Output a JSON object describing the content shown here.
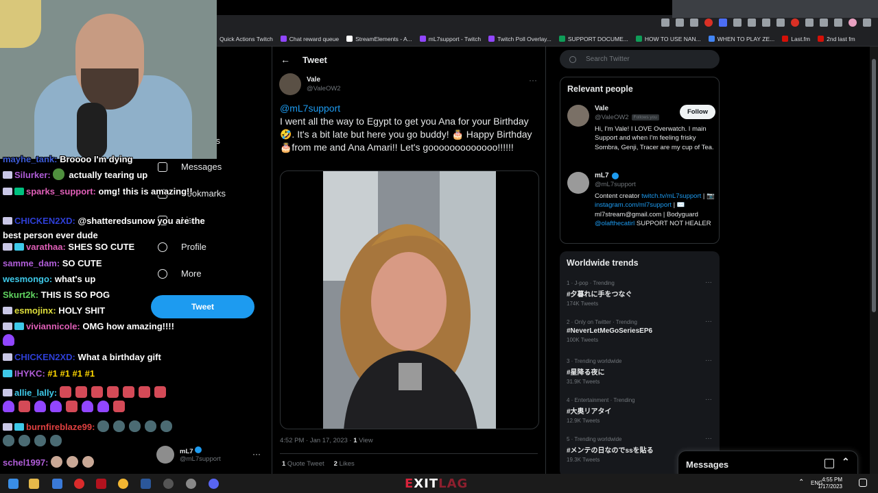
{
  "browser": {
    "bookmarks": [
      {
        "label": "Quick Actions Twitch",
        "color": ""
      },
      {
        "label": "Chat reward queue",
        "color": "#9146ff"
      },
      {
        "label": "StreamElements - A...",
        "color": "#ffffff"
      },
      {
        "label": "mL7support - Twitch",
        "color": "#9146ff"
      },
      {
        "label": "Twitch Poll Overlay...",
        "color": "#9146ff"
      },
      {
        "label": "SUPPORT DOCUME...",
        "color": "#0f9d58"
      },
      {
        "label": "HOW TO USE NAN...",
        "color": "#0f9d58"
      },
      {
        "label": "WHEN TO PLAY ZE...",
        "color": "#4285f4"
      },
      {
        "label": "Last.fm",
        "color": "#d51007"
      },
      {
        "label": "2nd last fm",
        "color": "#d51007"
      }
    ]
  },
  "nav": {
    "items": [
      {
        "label": "ons",
        "icon": "explore-icon"
      },
      {
        "label": "Messages",
        "icon": "mail-icon"
      },
      {
        "label": "Bookmarks",
        "icon": "bookmark-icon"
      },
      {
        "label": "Lists",
        "icon": "list-icon"
      },
      {
        "label": "Profile",
        "icon": "person-icon"
      },
      {
        "label": "More",
        "icon": "more-circle-icon"
      }
    ],
    "tweet_button": "Tweet",
    "account": {
      "name": "mL7",
      "handle": "@mL7support"
    }
  },
  "tweet": {
    "header": "Tweet",
    "author_name": "Vale",
    "author_handle": "@ValeOW2",
    "mention": "@mL7support",
    "text": "I went all the way to Egypt to get you Ana for your Birthday 🤣. It's a bit late but here you go buddy! 🎂 Happy Birthday 🎂from me and Ana Amari!! Let's gooooooooooooo!!!!!!",
    "timestamp": "4:52 PM · Jan 17, 2023 · ",
    "views_count": "1",
    "views_label": " View",
    "quote_count": "1",
    "quote_label": " Quote Tweet",
    "likes_count": "2",
    "likes_label": " Likes"
  },
  "sidebar": {
    "search_placeholder": "Search Twitter",
    "relevant_title": "Relevant people",
    "people": [
      {
        "name": "Vale",
        "handle": "@ValeOW2",
        "badge": "Follows you",
        "follow_label": "Follow",
        "bio": "Hi, I'm Vale! I LOVE Overwatch. I main Support and when I'm feeling frisky Sombra, Genji, Tracer are my cup of Tea."
      },
      {
        "name": "mL7",
        "handle": "@mL7support",
        "bio_pre": "Content creator ",
        "bio_link1": "twitch.tv/mL7support",
        "bio_mid1": " | 📷 ",
        "bio_link2": "instagram.com/ml7support",
        "bio_mid2": " | ✉️ ml7stream@gmail.com | Bodyguard ",
        "bio_link3": "@olafthecatirl",
        "bio_post": " SUPPORT NOT HEALER"
      }
    ],
    "trends_title": "Worldwide trends",
    "trends": [
      {
        "meta": "1 · J-pop · Trending",
        "tag": "#夕暮れに手をつなぐ",
        "count": "174K Tweets"
      },
      {
        "meta": "2 · Only on Twitter · Trending",
        "tag": "#NeverLetMeGoSeriesEP6",
        "count": "100K Tweets"
      },
      {
        "meta": "3 · Trending worldwide",
        "tag": "#星降る夜に",
        "count": "31.9K Tweets"
      },
      {
        "meta": "4 · Entertainment · Trending",
        "tag": "#大奥リアタイ",
        "count": "12.9K Tweets"
      },
      {
        "meta": "5 · Trending worldwide",
        "tag": "#メンテの日なのでssを貼る",
        "count": "19.3K Tweets"
      }
    ],
    "messages_label": "Messages"
  },
  "chat": {
    "lines": [
      {
        "user": "mayhe_tank:",
        "color": "#3c5bd6",
        "msg": " Broooo I'm dying",
        "badges": []
      },
      {
        "user": "Silurker:",
        "color": "#b05dd8",
        "msg": "actually tearing up",
        "badges": [
          "b"
        ],
        "emote": "frog"
      },
      {
        "user": "sparks_support:",
        "color": "#e05fb8",
        "msg": " omg! this is amazing!!",
        "badges": [
          "b",
          "g"
        ]
      },
      {
        "user": "CHICKEN2XD:",
        "color": "#2e3fd6",
        "msg": " @shatteredsunow you are the best person ever dude",
        "badges": [
          "b"
        ]
      },
      {
        "user": "varathaa:",
        "color": "#e05fb8",
        "msg": " SHES SO CUTE",
        "badges": [
          "b",
          "t"
        ]
      },
      {
        "user": "samme_dam:",
        "color": "#b05dd8",
        "msg": " SO CUTE",
        "badges": []
      },
      {
        "user": "wesmongo:",
        "color": "#3ec9e9",
        "msg": " what's up",
        "badges": []
      },
      {
        "user": "Skurt2k:",
        "color": "#5fd35f",
        "msg": " THIS IS SO POG",
        "badges": []
      },
      {
        "user": "esmojinx:",
        "color": "#e0e03c",
        "msg": " HOLY SHIT",
        "badges": [
          "b"
        ]
      },
      {
        "user": "viviannicole:",
        "color": "#e05fb8",
        "msg": " OMG how amazing!!!!",
        "badges": [
          "b",
          "t"
        ],
        "trail": "heart"
      },
      {
        "user": "CHICKEN2XD:",
        "color": "#2e3fd6",
        "msg": " What a birthday gift",
        "badges": [
          "b"
        ]
      },
      {
        "user": "IHYKC:",
        "color": "#b05dd8",
        "msg": " ",
        "badges": [
          "t"
        ],
        "nums": "#1 #1 #1 #1"
      },
      {
        "user": "allie_lally:",
        "color": "#3ec9e9",
        "msg": " ",
        "badges": [
          "b"
        ],
        "emotes": "cake"
      },
      {
        "user": "burnfireblaze99:",
        "color": "#e04040",
        "msg": " ",
        "badges": [
          "b",
          "t"
        ],
        "emotes": "blob"
      },
      {
        "user": "schel1997:",
        "color": "#b05dd8",
        "msg": " ",
        "badges": [],
        "emotes": "face"
      }
    ]
  },
  "taskbar": {
    "brand_a": "E",
    "brand_b": "XIT",
    "brand_c": "LAG",
    "lang": "ENG",
    "time": "4:55 PM",
    "date": "1/17/2023"
  }
}
